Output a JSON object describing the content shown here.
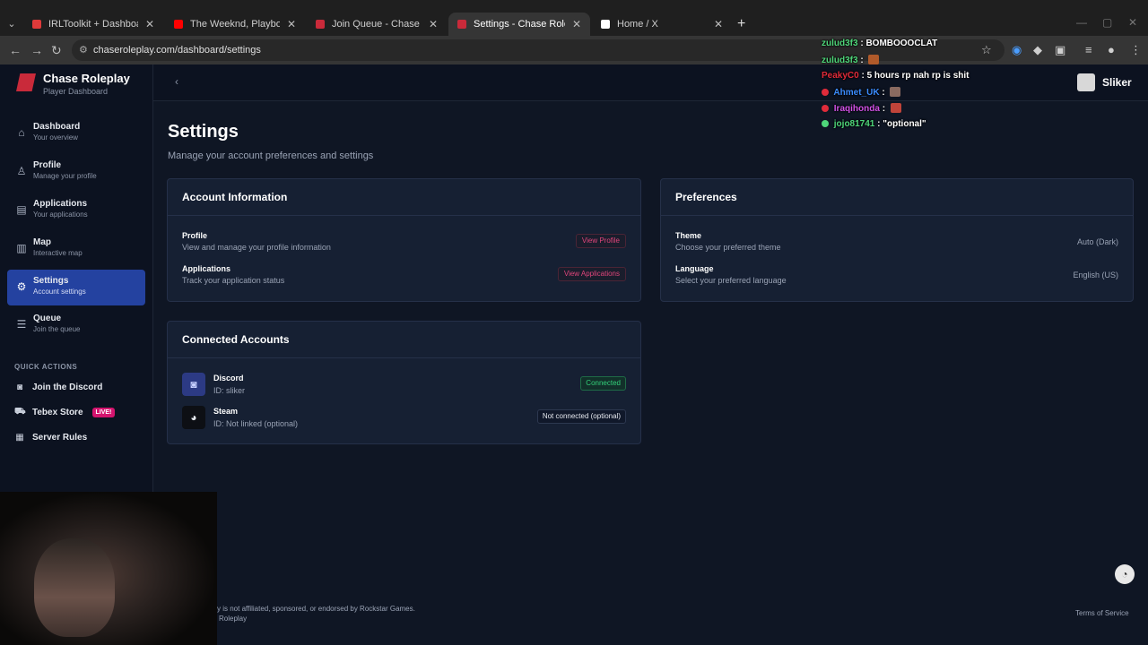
{
  "browser": {
    "tabs": [
      {
        "title": "IRLToolkit + Dashboard",
        "color": "#e03a3a"
      },
      {
        "title": "The Weeknd, Playboi Carti - Tin",
        "color": "#ff0000"
      },
      {
        "title": "Join Queue - Chase Roleplay",
        "color": "#c92a3a"
      },
      {
        "title": "Settings - Chase Roleplay",
        "color": "#c92a3a",
        "active": true
      },
      {
        "title": "Home / X",
        "color": "#ffffff"
      }
    ],
    "url": "chaseroleplay.com/dashboard/settings"
  },
  "sidebar": {
    "brand_name": "Chase Roleplay",
    "brand_sub": "Player Dashboard",
    "items": [
      {
        "label": "Dashboard",
        "sub": "Your overview",
        "icon": "home-icon"
      },
      {
        "label": "Profile",
        "sub": "Manage your profile",
        "icon": "user-icon"
      },
      {
        "label": "Applications",
        "sub": "Your applications",
        "icon": "document-icon"
      },
      {
        "label": "Map",
        "sub": "Interactive map",
        "icon": "map-icon"
      },
      {
        "label": "Settings",
        "sub": "Account settings",
        "icon": "gear-icon",
        "active": true
      },
      {
        "label": "Queue",
        "sub": "Join the queue",
        "icon": "list-icon"
      }
    ],
    "quick_actions_title": "QUICK ACTIONS",
    "quick_actions": [
      {
        "label": "Join the Discord",
        "icon": "discord-icon"
      },
      {
        "label": "Tebex Store",
        "icon": "cart-icon",
        "badge": "LIVE!"
      },
      {
        "label": "Server Rules",
        "icon": "rules-icon"
      }
    ]
  },
  "header": {
    "user_name": "Sliker"
  },
  "page": {
    "title": "Settings",
    "subtitle": "Manage your account preferences and settings"
  },
  "account_info": {
    "title": "Account Information",
    "rows": [
      {
        "label": "Profile",
        "sub": "View and manage your profile information",
        "button": "View Profile"
      },
      {
        "label": "Applications",
        "sub": "Track your application status",
        "button": "View Applications"
      }
    ]
  },
  "preferences": {
    "title": "Preferences",
    "rows": [
      {
        "label": "Theme",
        "sub": "Choose your preferred theme",
        "value": "Auto (Dark)"
      },
      {
        "label": "Language",
        "sub": "Select your preferred language",
        "value": "English (US)"
      }
    ]
  },
  "connected_accounts": {
    "title": "Connected Accounts",
    "accounts": [
      {
        "name": "Discord",
        "id": "ID: sliker",
        "status": "Connected"
      },
      {
        "name": "Steam",
        "id": "ID: Not linked (optional)",
        "status": "Not connected (optional)"
      }
    ]
  },
  "chat": [
    {
      "user": "zulud3f3",
      "color": "#4fd67a",
      "message": ": BOMBOOOCLAT"
    },
    {
      "user": "zulud3f3",
      "color": "#4fd67a",
      "message": ":"
    },
    {
      "user": "PeakyC0",
      "color": "#e02b3a",
      "message": ": 5 hours rp nah rp is shit"
    },
    {
      "user": "Ahmet_UK",
      "color": "#3b8cff",
      "message": ":"
    },
    {
      "user": "Iraqihonda",
      "color": "#d152e6",
      "message": ":"
    },
    {
      "user": "jojo81741",
      "color": "#4fd67a",
      "message": ": \"optional\""
    }
  ],
  "footer": {
    "disclaimer": "y is not affiliated, sponsored, or endorsed by Rockstar Games.",
    "copyright": "Roleplay",
    "terms": "Terms of Service"
  }
}
